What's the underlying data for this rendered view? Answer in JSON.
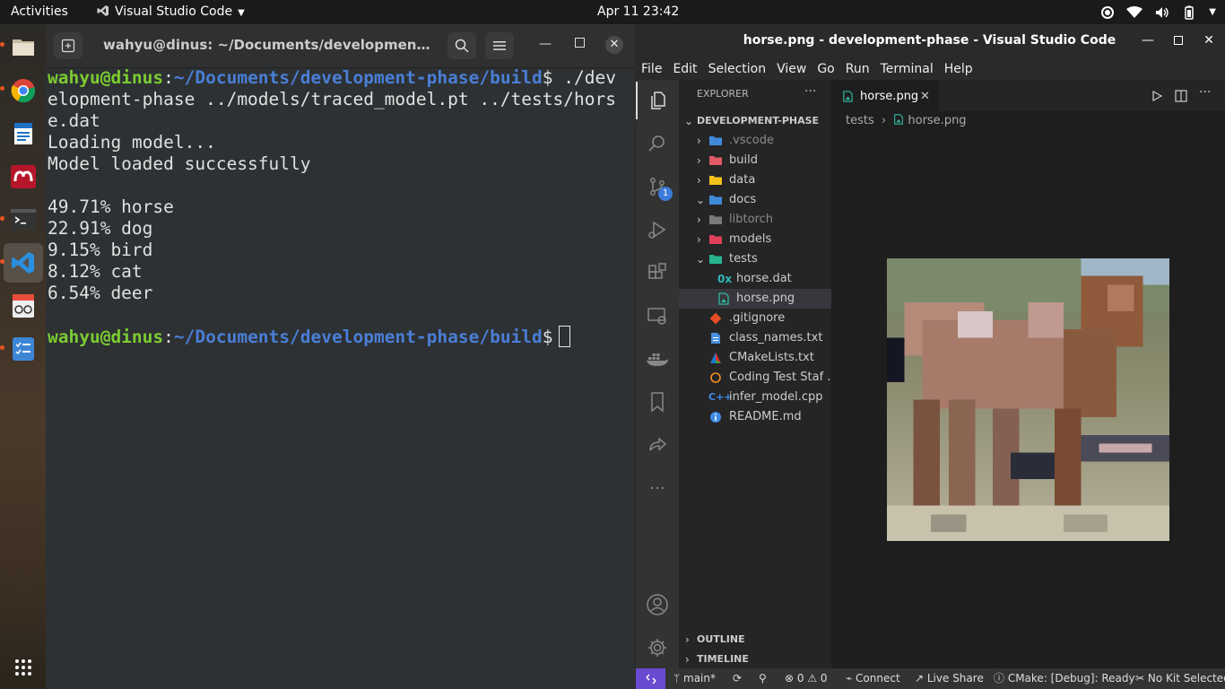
{
  "topbar": {
    "activities": "Activities",
    "app_name": "Visual Studio Code",
    "datetime": "Apr 11  23:42"
  },
  "dock": {
    "items": [
      "files-icon",
      "chrome-icon",
      "document-icon",
      "mendeley-icon",
      "terminal-icon",
      "vscode-icon",
      "reader-icon",
      "checklist-icon"
    ]
  },
  "terminal": {
    "title": "wahyu@dinus: ~/Documents/development-phase...",
    "user": "wahyu@dinus",
    "path": "~/Documents/development-phase/build",
    "command_part1": " ./dev",
    "command_part2": "elopment-phase ../models/traced_model.pt ../tests/hors",
    "command_part3": "e.dat",
    "out1": "Loading model...",
    "out2": "Model loaded successfully",
    "results": [
      "49.71% horse",
      "22.91% dog",
      "9.15% bird",
      "8.12% cat",
      "6.54% deer"
    ]
  },
  "vscode": {
    "title": "horse.png - development-phase - Visual Studio Code",
    "menu": [
      "File",
      "Edit",
      "Selection",
      "View",
      "Go",
      "Run",
      "Terminal",
      "Help"
    ],
    "explorer_label": "EXPLORER",
    "folder": "DEVELOPMENT-PHASE",
    "tree": [
      {
        "label": ".vscode",
        "color": "#8a8a8a"
      },
      {
        "label": "build",
        "color": "#ccc"
      },
      {
        "label": "data",
        "color": "#ccc"
      },
      {
        "label": "docs",
        "color": "#ccc"
      },
      {
        "label": "libtorch",
        "color": "#8a8a8a"
      },
      {
        "label": "models",
        "color": "#ccc"
      },
      {
        "label": "tests",
        "color": "#ccc"
      },
      {
        "label": "horse.dat",
        "color": "#ccc"
      },
      {
        "label": "horse.png",
        "color": "#ccc"
      },
      {
        "label": ".gitignore",
        "color": "#ccc"
      },
      {
        "label": "class_names.txt",
        "color": "#ccc"
      },
      {
        "label": "CMakeLists.txt",
        "color": "#ccc"
      },
      {
        "label": "Coding Test Staf ...",
        "color": "#ccc"
      },
      {
        "label": "infer_model.cpp",
        "color": "#ccc"
      },
      {
        "label": "README.md",
        "color": "#ccc"
      }
    ],
    "outline": "OUTLINE",
    "timeline": "TIMELINE",
    "tab": "horse.png",
    "breadcrumb_folder": "tests",
    "breadcrumb_file": "horse.png",
    "source_control_badge": "1",
    "status": {
      "branch": "main*",
      "errors": "0",
      "warnings": "0",
      "connect": "Connect",
      "liveshare": "Live Share",
      "cmake": "CMake: [Debug]: Ready",
      "kit": "No Kit Selected"
    }
  }
}
